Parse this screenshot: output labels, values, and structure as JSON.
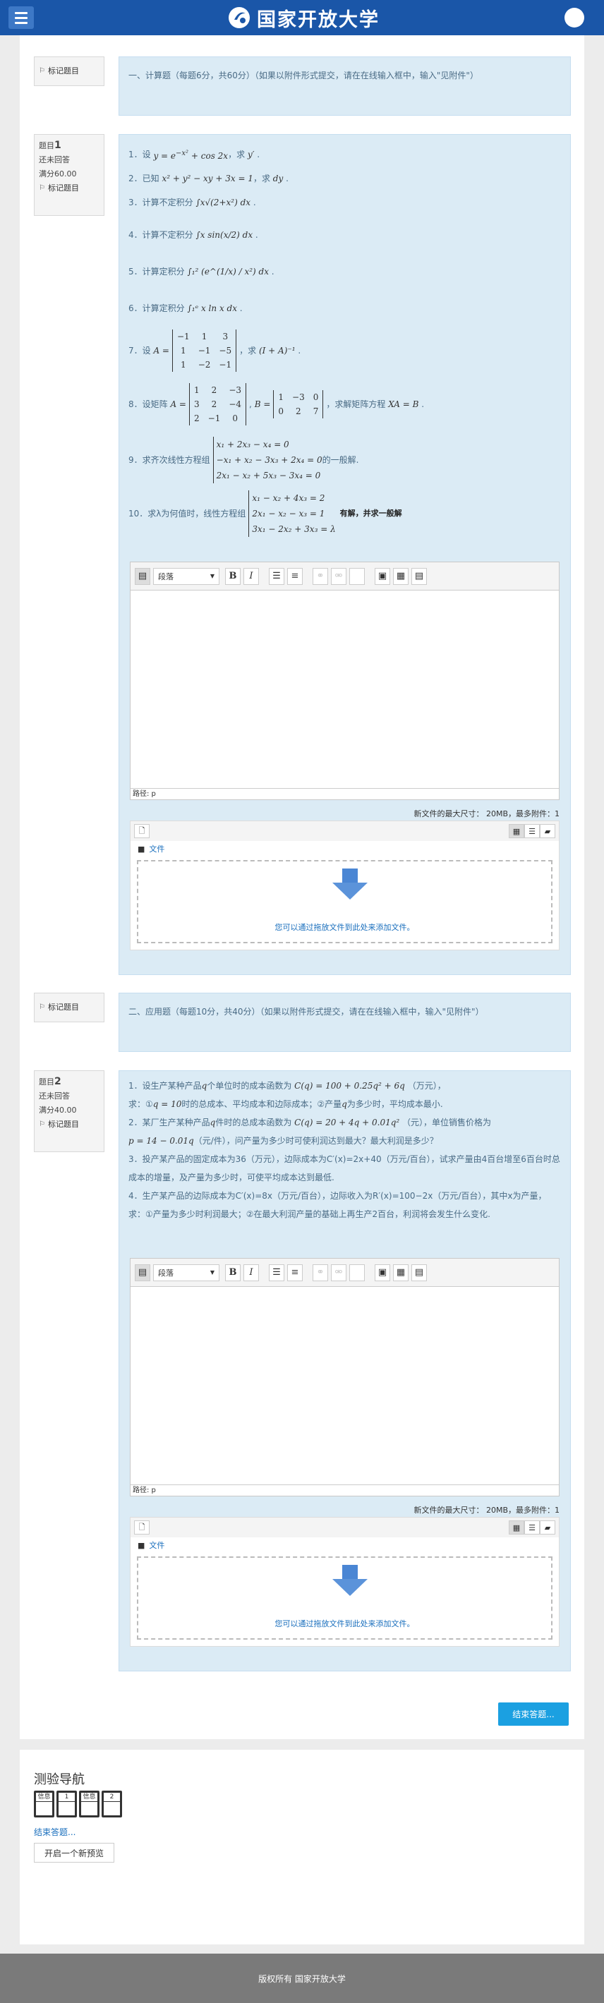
{
  "header": {
    "logo_text": "国家开放大学",
    "menu_icon": "hamburger-icon",
    "avatar_icon": "user-avatar",
    "brand_color": "#1a56a8"
  },
  "section1": {
    "flag_label": "标记题目",
    "text": "一、计算题（每题6分，共60分）（如果以附件形式提交，请在在线输入框中，输入\"见附件\"）"
  },
  "q1": {
    "no_prefix": "题目",
    "no": "1",
    "status": "还未回答",
    "grade": "满分60.00",
    "flag_label": "标记题目",
    "items": {
      "i1a": "1．设",
      "i1b": "，求",
      "i2a": "2．已知",
      "i2b": "，求",
      "i3": "3．计算不定积分",
      "i4": "4．计算不定积分",
      "i5": "5．计算定积分",
      "i6": "6．计算定积分",
      "i7a": "7．设",
      "i7b": "，求",
      "i8a": "8．设矩阵",
      "i8b": "，求解矩阵方程",
      "i9a": "9．求齐次线性方程组",
      "i9b": "的一般解.",
      "i10a": "10．求λ为何值时，线性方程组",
      "i10b": "有解，并求一般解"
    }
  },
  "editor": {
    "paragraph": "段落",
    "path": "路径: p",
    "maxsize": "新文件的最大尺寸：  20MB，最多附件：1",
    "files_link": "文件",
    "drop_text": "您可以通过拖放文件到此处来添加文件。"
  },
  "section2": {
    "flag_label": "标记题目",
    "text": "二、应用题（每题10分，共40分）（如果以附件形式提交，请在在线输入框中，输入\"见附件\"）"
  },
  "q2": {
    "no_prefix": "题目",
    "no": "2",
    "status": "还未回答",
    "grade": "满分40.00",
    "flag_label": "标记题目",
    "p1a": "1．设生产某种产品",
    "p1b": "个单位时的成本函数为",
    "p1c": "（万元），",
    "p1d": "求：①",
    "p1e": "时的总成本、平均成本和边际成本；②产量",
    "p1f": "为多少时，平均成本最小.",
    "p2a": "2．某厂生产某种产品",
    "p2b": "件时的总成本函数为",
    "p2c": "（元），单位销售价格为",
    "p2d": "（元/件），问产量为多少时可使利润达到最大？最大利润是多少？",
    "p3": "3．投产某产品的固定成本为36（万元），边际成本为C′(x)=2x+40（万元/百台），试求产量由4百台增至6百台时总成本的增量，及产量为多少时，可使平均成本达到最低.",
    "p4": "4．生产某产品的边际成本为C′(x)=8x（万元/百台），边际收入为R′(x)=100−2x（万元/百台），其中x为产量，求：①产量为多少时利润最大；②在最大利润产量的基础上再生产2百台，利润将会发生什么变化."
  },
  "finish_button": "结束答题...",
  "nav": {
    "title": "测验导航",
    "boxes": [
      {
        "label": "信息",
        "value": ""
      },
      {
        "label": "1",
        "value": ""
      },
      {
        "label": "信息",
        "value": ""
      },
      {
        "label": "2",
        "value": ""
      }
    ],
    "finish_link": "结束答题...",
    "new_preview": "开启一个新预览"
  },
  "footer": "版权所有 国家开放大学"
}
